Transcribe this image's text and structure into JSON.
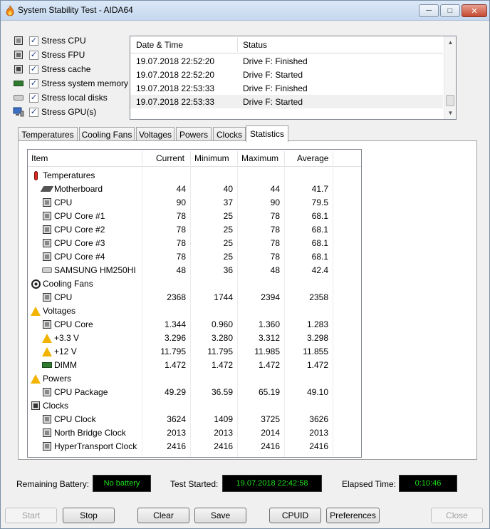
{
  "window": {
    "title": "System Stability Test - AIDA64"
  },
  "stress": [
    {
      "label": "Stress CPU",
      "checked": true,
      "icon": "cpu-icon"
    },
    {
      "label": "Stress FPU",
      "checked": true,
      "icon": "fpu-icon"
    },
    {
      "label": "Stress cache",
      "checked": true,
      "icon": "cache-icon"
    },
    {
      "label": "Stress system memory",
      "checked": true,
      "icon": "memory-icon"
    },
    {
      "label": "Stress local disks",
      "checked": true,
      "icon": "disk-icon"
    },
    {
      "label": "Stress GPU(s)",
      "checked": true,
      "icon": "gpu-icon"
    }
  ],
  "log": {
    "headers": [
      "Date & Time",
      "Status"
    ],
    "rows": [
      [
        "19.07.2018 22:52:20",
        "Drive F: Finished"
      ],
      [
        "19.07.2018 22:52:20",
        "Drive F: Started"
      ],
      [
        "19.07.2018 22:53:33",
        "Drive F: Finished"
      ],
      [
        "19.07.2018 22:53:33",
        "Drive F: Started"
      ]
    ]
  },
  "tabs": [
    "Temperatures",
    "Cooling Fans",
    "Voltages",
    "Powers",
    "Clocks",
    "Statistics"
  ],
  "stats": {
    "headers": [
      "Item",
      "Current",
      "Minimum",
      "Maximum",
      "Average"
    ],
    "rows": [
      {
        "group": true,
        "icon": "thermometer",
        "name": "Temperatures"
      },
      {
        "icon": "motherboard",
        "name": "Motherboard",
        "cur": "44",
        "min": "40",
        "max": "44",
        "avg": "41.7"
      },
      {
        "icon": "chip",
        "name": "CPU",
        "cur": "90",
        "min": "37",
        "max": "90",
        "avg": "79.5"
      },
      {
        "icon": "chip",
        "name": "CPU Core #1",
        "cur": "78",
        "min": "25",
        "max": "78",
        "avg": "68.1"
      },
      {
        "icon": "chip",
        "name": "CPU Core #2",
        "cur": "78",
        "min": "25",
        "max": "78",
        "avg": "68.1"
      },
      {
        "icon": "chip",
        "name": "CPU Core #3",
        "cur": "78",
        "min": "25",
        "max": "78",
        "avg": "68.1"
      },
      {
        "icon": "chip",
        "name": "CPU Core #4",
        "cur": "78",
        "min": "25",
        "max": "78",
        "avg": "68.1"
      },
      {
        "icon": "hdd",
        "name": "SAMSUNG HM250HI",
        "cur": "48",
        "min": "36",
        "max": "48",
        "avg": "42.4"
      },
      {
        "group": true,
        "icon": "fan",
        "name": "Cooling Fans"
      },
      {
        "icon": "chip",
        "name": "CPU",
        "cur": "2368",
        "min": "1744",
        "max": "2394",
        "avg": "2358"
      },
      {
        "group": true,
        "icon": "warning",
        "name": "Voltages"
      },
      {
        "icon": "chip",
        "name": "CPU Core",
        "cur": "1.344",
        "min": "0.960",
        "max": "1.360",
        "avg": "1.283"
      },
      {
        "icon": "warning",
        "name": "+3.3 V",
        "cur": "3.296",
        "min": "3.280",
        "max": "3.312",
        "avg": "3.298"
      },
      {
        "icon": "warning",
        "name": "+12 V",
        "cur": "11.795",
        "min": "11.795",
        "max": "11.985",
        "avg": "11.855"
      },
      {
        "icon": "ram",
        "name": "DIMM",
        "cur": "1.472",
        "min": "1.472",
        "max": "1.472",
        "avg": "1.472"
      },
      {
        "group": true,
        "icon": "warning",
        "name": "Powers"
      },
      {
        "icon": "chip",
        "name": "CPU Package",
        "cur": "49.29",
        "min": "36.59",
        "max": "65.19",
        "avg": "49.10"
      },
      {
        "group": true,
        "icon": "clock",
        "name": "Clocks"
      },
      {
        "icon": "chip",
        "name": "CPU Clock",
        "cur": "3624",
        "min": "1409",
        "max": "3725",
        "avg": "3626"
      },
      {
        "icon": "chip",
        "name": "North Bridge Clock",
        "cur": "2013",
        "min": "2013",
        "max": "2014",
        "avg": "2013"
      },
      {
        "icon": "chip",
        "name": "HyperTransport Clock",
        "cur": "2416",
        "min": "2416",
        "max": "2416",
        "avg": "2416"
      }
    ]
  },
  "status": {
    "battery_label": "Remaining Battery:",
    "battery_value": "No battery",
    "started_label": "Test Started:",
    "started_value": "19.07.2018 22:42:58",
    "elapsed_label": "Elapsed Time:",
    "elapsed_value": "0:10:46"
  },
  "buttons": {
    "start": "Start",
    "stop": "Stop",
    "clear": "Clear",
    "save": "Save",
    "cpuid": "CPUID",
    "preferences": "Preferences",
    "close": "Close"
  },
  "colors": {
    "lcd_text": "#1ee01e",
    "lcd_bg": "#000000"
  }
}
